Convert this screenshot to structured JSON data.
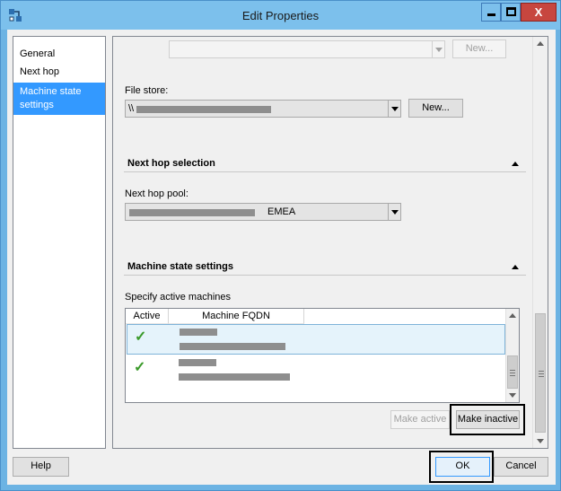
{
  "window": {
    "title": "Edit Properties",
    "close_glyph": "X"
  },
  "nav": {
    "items": [
      {
        "label": "General"
      },
      {
        "label": "Next hop"
      },
      {
        "label": "Machine state settings"
      }
    ]
  },
  "top_row": {
    "new_label": "New..."
  },
  "file_store": {
    "label": "File store:",
    "value_prefix": "\\\\",
    "new_label": "New..."
  },
  "next_hop": {
    "section_title": "Next hop selection",
    "pool_label": "Next hop pool:",
    "pool_value_suffix": "EMEA"
  },
  "machine_state": {
    "section_title": "Machine state settings",
    "list_label": "Specify active machines",
    "columns": [
      "Active",
      "Machine FQDN"
    ],
    "make_active_label": "Make active",
    "make_inactive_label": "Make inactive"
  },
  "footer": {
    "help_label": "Help",
    "ok_label": "OK",
    "cancel_label": "Cancel"
  },
  "colors": {
    "title_bar": "#7cc0ec",
    "selection": "#3399ff",
    "close_button": "#c7463f",
    "check": "#3a9a2a"
  }
}
